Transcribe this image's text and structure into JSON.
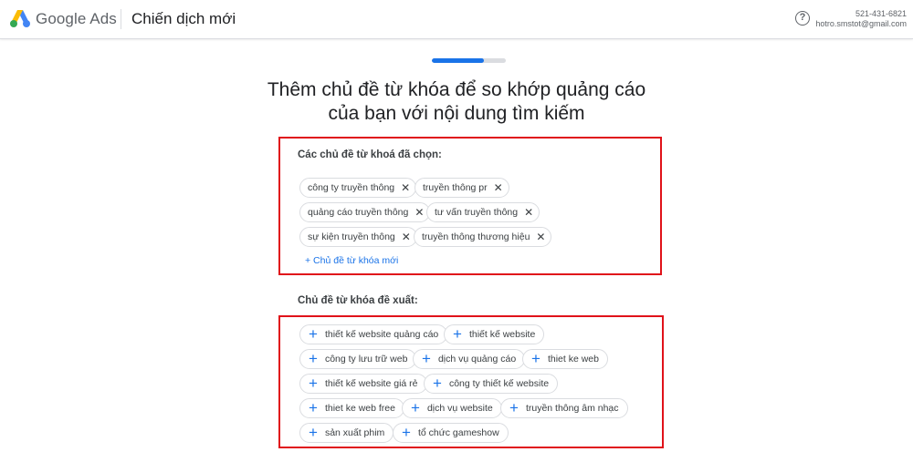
{
  "header": {
    "brand": "Google Ads",
    "title": "Chiến dịch mới",
    "account_id": "521-431-6821",
    "account_email": "hotro.smstot@gmail.com",
    "help_icon_glyph": "?"
  },
  "progress": {
    "value": 0.7
  },
  "heading": {
    "line1": "Thêm chủ đề từ khóa để so khớp quảng cáo",
    "line2": "của bạn với nội dung tìm kiếm"
  },
  "selected": {
    "label": "Các chủ đề từ khoá đã chọn:",
    "remove_glyph": "✕",
    "chips": [
      "công ty truyền thông",
      "truyền thông pr",
      "quảng cáo truyền thông",
      "tư vấn truyền thông",
      "sự kiện truyền thông",
      "truyền thông thương hiệu"
    ],
    "add_link": "+ Chủ đề từ khóa mới"
  },
  "suggested": {
    "label": "Chủ đề từ khóa đề xuất:",
    "add_glyph": "+",
    "chips": [
      "thiết kế website quảng cáo",
      "thiết kế website",
      "công ty lưu trữ web",
      "dịch vụ quảng cáo",
      "thiet ke web",
      "thiết kế website giá rẻ",
      "công ty thiết kế website",
      "thiet ke web free",
      "dịch vụ website",
      "truyền thông âm nhạc",
      "sản xuất phim",
      "tổ chức gameshow"
    ]
  },
  "colors": {
    "accent": "#1a73e8",
    "highlight_box": "#e0121a",
    "logo_yellow": "#fbbc04",
    "logo_blue": "#4285f4",
    "logo_green": "#34a853"
  }
}
